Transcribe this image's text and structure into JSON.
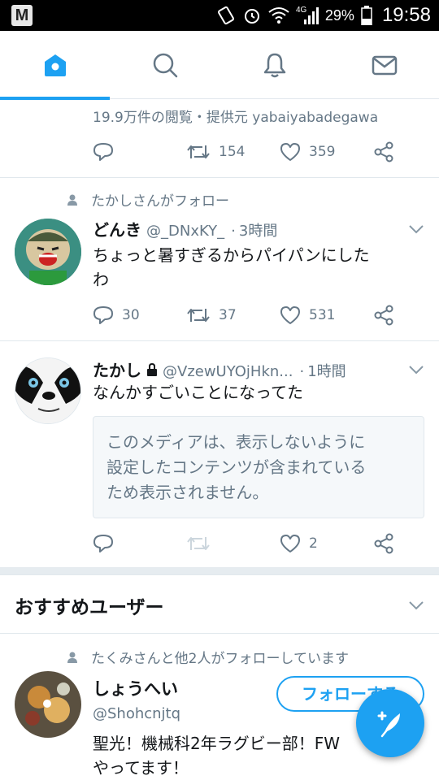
{
  "status_bar": {
    "carrier_badge": "M",
    "network": "4G",
    "battery_percent": "29%",
    "time": "19:58"
  },
  "tabs": [
    {
      "name": "home",
      "icon": "home-icon",
      "active": true
    },
    {
      "name": "search",
      "icon": "search-icon",
      "active": false
    },
    {
      "name": "notifications",
      "icon": "bell-icon",
      "active": false
    },
    {
      "name": "messages",
      "icon": "envelope-icon",
      "active": false
    }
  ],
  "promoted_tweet": {
    "views_line": "19.9万件の閲覧・提供元 yabaiyabadegawa",
    "retweets": "154",
    "likes": "359"
  },
  "tweet1": {
    "social_context": "たかしさんがフォロー",
    "display_name": "どんき",
    "handle": "@_DNxKY_",
    "dot": "·",
    "time": "3時間",
    "text_line1": "ちょっと暑すぎるからパイパンにした",
    "text_line2": "わ",
    "replies": "30",
    "retweets": "37",
    "likes": "531"
  },
  "tweet2": {
    "display_name": "たかし",
    "protected": true,
    "handle": "@VzewUYOjHkn...",
    "dot": "·",
    "time": "1時間",
    "text": "なんかすごいことになってた",
    "sensitive_line1": "このメディアは、表示しないように",
    "sensitive_line2": "設定したコンテンツが含まれている",
    "sensitive_line3": "ため表示されません。",
    "likes": "2"
  },
  "recommended": {
    "title": "おすすめユーザー",
    "user": {
      "social_context": "たくみさんと他2人がフォローしています",
      "display_name": "しょうへい",
      "handle": "@Shohcnjtq",
      "follow_label": "フォローする",
      "bio_line1": "聖光！機械科2年ラグビー部！FW",
      "bio_line2": "やってます！"
    }
  },
  "colors": {
    "accent": "#1da1f2",
    "secondary_text": "#657786",
    "divider": "#e1e8ed"
  }
}
